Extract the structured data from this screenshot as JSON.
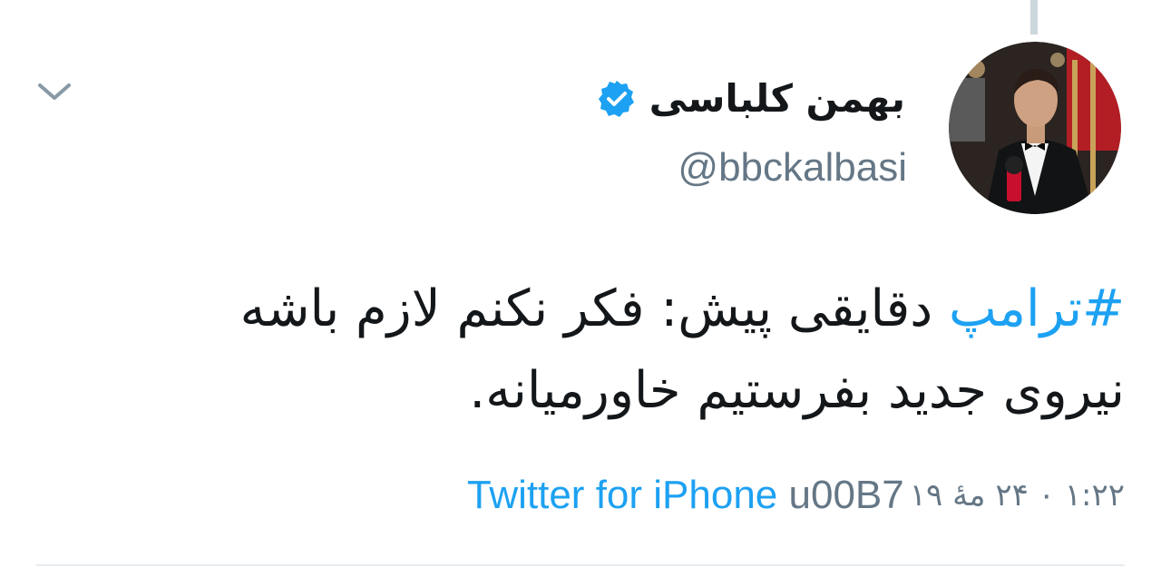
{
  "tweet": {
    "author": {
      "display_name": "بهمن کلباسی",
      "handle": "@bbckalbasi",
      "verified": true,
      "avatar_icon": "profile-photo"
    },
    "text": {
      "hashtag": "#ترامپ",
      "line1_rest": " دقایقی پیش: فکر نکنم لازم باشه",
      "line2": "نیروی جدید بفرستیم خاورمیانه."
    },
    "meta": {
      "source": "Twitter for iPhone",
      "separator": "u00B7",
      "timestamp": "۱:۲۲ ۰ ۲۴ مهٔ ۱۹"
    },
    "menu_icon": "chevron-down-icon",
    "colors": {
      "link": "#1da1f2",
      "muted": "#657786",
      "text": "#14171a",
      "divider": "#e6ecf0"
    }
  }
}
